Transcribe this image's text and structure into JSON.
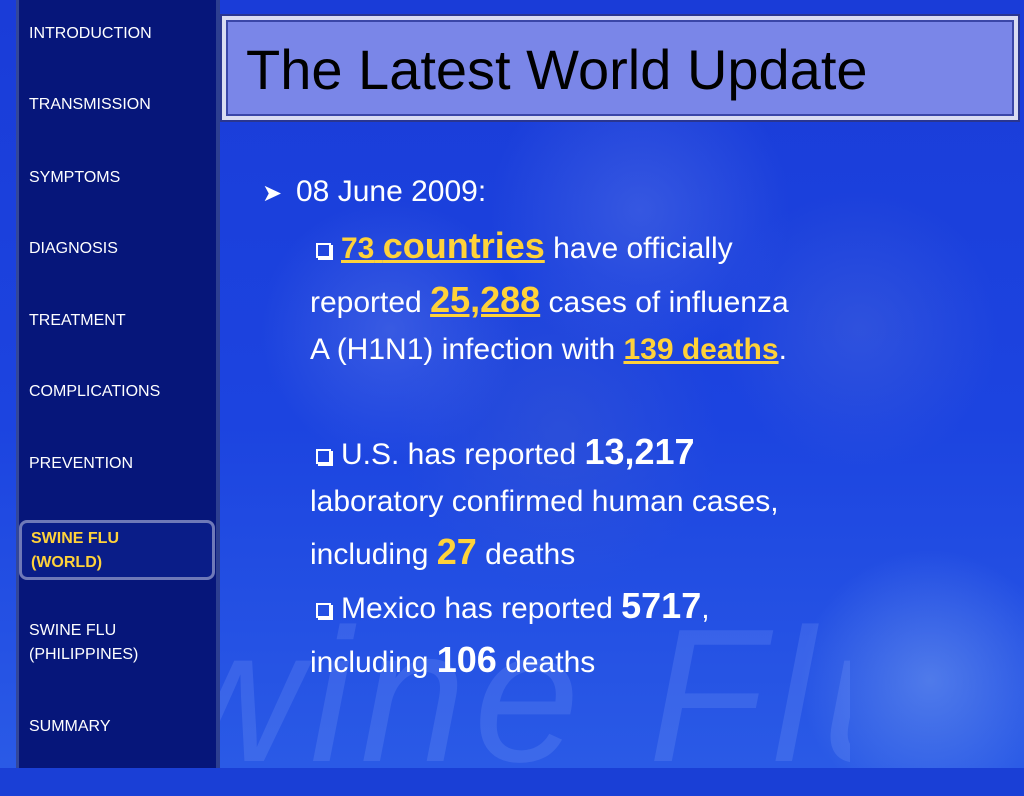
{
  "nav": {
    "introduction": "INTRODUCTION",
    "transmission": "TRANSMISSION",
    "symptoms": "SYMPTOMS",
    "diagnosis": "DIAGNOSIS",
    "treatment": "TREATMENT",
    "complications": "COMPLICATIONS",
    "prevention": "PREVENTION",
    "swine_world_1": "SWINE FLU",
    "swine_world_2": "(WORLD)",
    "swine_ph_1": "SWINE FLU",
    "swine_ph_2": "(PHILIPPINES)",
    "summary": "SUMMARY"
  },
  "title": "The Latest World Update",
  "content": {
    "date": "08 June 2009:",
    "b1_num": "73",
    "b1_countries": "countries",
    "b1_rest1": " have officially",
    "b1_reported": "reported ",
    "b1_cases": "25,288",
    "b1_rest2": " cases of influenza",
    "b1_rest3": "A (H1N1) infection with ",
    "b1_deaths": "139 deaths",
    "b1_period": ".",
    "b2_text": "U.S. has reported ",
    "b2_num": "13,217",
    "b2_line2": "laboratory confirmed human cases,",
    "b2_incl": "including ",
    "b2_deaths": "27",
    "b2_deaths_word": " deaths",
    "b3_text": "Mexico has reported ",
    "b3_num": "5717",
    "b3_comma": ",",
    "b3_incl": "including ",
    "b3_deaths": "106",
    "b3_deaths_word": " deaths"
  },
  "watermark": "Swine Flu",
  "colors": {
    "highlight": "#ffd23a",
    "sidebar": "#06167a",
    "title_bg": "#7a86e8",
    "background": "#1c44e0"
  }
}
